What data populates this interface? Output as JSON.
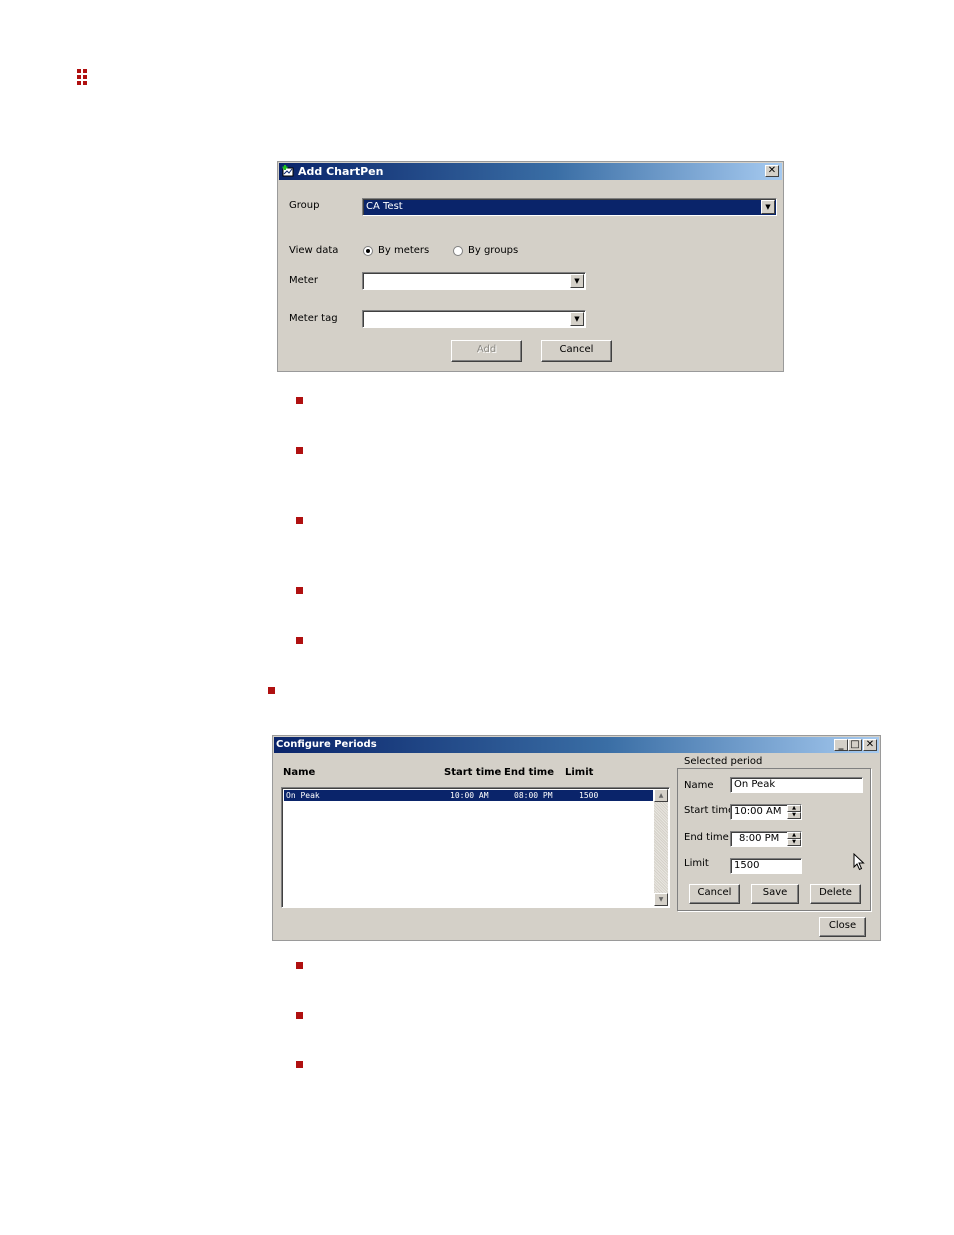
{
  "dialog1": {
    "title": "Add ChartPen",
    "close_glyph": "✕",
    "group_label": "Group",
    "group_value": "CA Test",
    "view_data_label": "View data",
    "radio_by_meters": "By meters",
    "radio_by_groups": "By groups",
    "selected_view": "By meters",
    "meter_label": "Meter",
    "meter_value": "",
    "meter_tag_label": "Meter tag",
    "meter_tag_value": "",
    "add_button": "Add",
    "cancel_button": "Cancel"
  },
  "dialog2": {
    "title": "Configure Periods",
    "columns": [
      "Name",
      "Start time",
      "End time",
      "Limit"
    ],
    "rows": [
      {
        "name": "On Peak",
        "start": "10:00 AM",
        "end": "08:00 PM",
        "limit": "1500"
      }
    ],
    "group_title": "Selected period",
    "name_label": "Name",
    "name_value": "On Peak",
    "start_label": "Start time",
    "start_value": "10:00 AM",
    "end_label": "End time",
    "end_value": "8:00 PM",
    "limit_label": "Limit",
    "limit_value": "1500",
    "cancel_button": "Cancel",
    "save_button": "Save",
    "delete_button": "Delete",
    "close_button": "Close"
  },
  "colors": {
    "bullet": "#b01010",
    "titlebar_start": "#0a246a",
    "titlebar_end": "#a6caf0",
    "dialog_bg": "#d4d0c8",
    "selection": "#0a246a"
  }
}
